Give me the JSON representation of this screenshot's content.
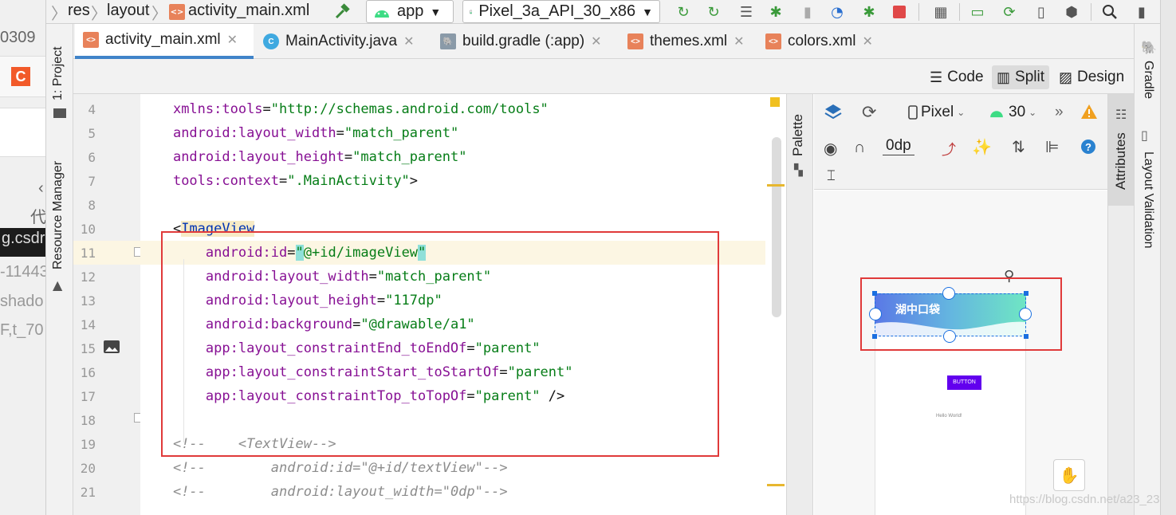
{
  "browser_strip": {
    "text1": "0309",
    "c_label": "C",
    "text2": "代",
    "dark_text": "g.csdr",
    "text3": "-11443",
    "text4": "shado",
    "text5": "F,t_70"
  },
  "toolbar": {
    "breadcrumbs": [
      "res",
      "layout",
      "activity_main.xml"
    ],
    "run_config": "app",
    "device": "Pixel_3a_API_30_x86"
  },
  "left_tools": {
    "project": "1: Project",
    "resource_manager": "Resource Manager"
  },
  "tabs": [
    {
      "label": "activity_main.xml",
      "active": true,
      "icon": "xml-file-icon"
    },
    {
      "label": "MainActivity.java",
      "active": false,
      "icon": "java-class-icon"
    },
    {
      "label": "build.gradle (:app)",
      "active": false,
      "icon": "gradle-icon"
    },
    {
      "label": "themes.xml",
      "active": false,
      "icon": "xml-file-icon"
    },
    {
      "label": "colors.xml",
      "active": false,
      "icon": "xml-file-icon"
    }
  ],
  "modes": {
    "code": "Code",
    "split": "Split",
    "design": "Design",
    "active": "Split"
  },
  "editor": {
    "lines": [
      {
        "n": "4",
        "parts": [
          {
            "t": "    "
          },
          {
            "c": "attr",
            "t": "xmlns:tools"
          },
          {
            "c": "punct",
            "t": "="
          },
          {
            "c": "val",
            "t": "\"http://schemas.android.com/tools\""
          }
        ]
      },
      {
        "n": "5",
        "parts": [
          {
            "t": "    "
          },
          {
            "c": "attr",
            "t": "android:layout_width"
          },
          {
            "c": "punct",
            "t": "="
          },
          {
            "c": "val",
            "t": "\"match_parent\""
          }
        ]
      },
      {
        "n": "6",
        "parts": [
          {
            "t": "    "
          },
          {
            "c": "attr",
            "t": "android:layout_height"
          },
          {
            "c": "punct",
            "t": "="
          },
          {
            "c": "val",
            "t": "\"match_parent\""
          }
        ]
      },
      {
        "n": "7",
        "parts": [
          {
            "t": "    "
          },
          {
            "c": "attr",
            "t": "tools:context"
          },
          {
            "c": "punct",
            "t": "="
          },
          {
            "c": "val",
            "t": "\".MainActivity\""
          },
          {
            "c": "punct",
            "t": ">"
          }
        ]
      },
      {
        "n": "8",
        "parts": []
      },
      {
        "n": "10",
        "parts": [
          {
            "t": "    "
          },
          {
            "c": "punct",
            "t": "<"
          },
          {
            "c": "tag tagbg",
            "t": "ImageView"
          }
        ]
      },
      {
        "n": "11",
        "current": true,
        "parts": [
          {
            "t": "        "
          },
          {
            "c": "attr",
            "t": "android:id"
          },
          {
            "c": "punct",
            "t": "="
          },
          {
            "c": "val hl",
            "t": "\""
          },
          {
            "c": "val",
            "t": "@+id/imageView"
          },
          {
            "c": "val hl",
            "t": "\""
          }
        ]
      },
      {
        "n": "12",
        "parts": [
          {
            "t": "        "
          },
          {
            "c": "attr",
            "t": "android:layout_width"
          },
          {
            "c": "punct",
            "t": "="
          },
          {
            "c": "val",
            "t": "\"match_parent\""
          }
        ]
      },
      {
        "n": "13",
        "parts": [
          {
            "t": "        "
          },
          {
            "c": "attr",
            "t": "android:layout_height"
          },
          {
            "c": "punct",
            "t": "="
          },
          {
            "c": "val",
            "t": "\"117dp\""
          }
        ]
      },
      {
        "n": "14",
        "parts": [
          {
            "t": "        "
          },
          {
            "c": "attr",
            "t": "android:background"
          },
          {
            "c": "punct",
            "t": "="
          },
          {
            "c": "val",
            "t": "\"@drawable/a1\""
          }
        ]
      },
      {
        "n": "15",
        "parts": [
          {
            "t": "        "
          },
          {
            "c": "attr",
            "t": "app:layout_constraintEnd_toEndOf"
          },
          {
            "c": "punct",
            "t": "="
          },
          {
            "c": "val",
            "t": "\"parent\""
          }
        ]
      },
      {
        "n": "16",
        "parts": [
          {
            "t": "        "
          },
          {
            "c": "attr",
            "t": "app:layout_constraintStart_toStartOf"
          },
          {
            "c": "punct",
            "t": "="
          },
          {
            "c": "val",
            "t": "\"parent\""
          }
        ]
      },
      {
        "n": "17",
        "parts": [
          {
            "t": "        "
          },
          {
            "c": "attr",
            "t": "app:layout_constraintTop_toTopOf"
          },
          {
            "c": "punct",
            "t": "="
          },
          {
            "c": "val",
            "t": "\"parent\""
          },
          {
            "c": "punct",
            "t": " />"
          }
        ]
      },
      {
        "n": "18",
        "parts": []
      },
      {
        "n": "19",
        "parts": [
          {
            "t": "    "
          },
          {
            "c": "comment",
            "t": "<!--    <TextView-->"
          }
        ]
      },
      {
        "n": "20",
        "parts": [
          {
            "t": "    "
          },
          {
            "c": "comment",
            "t": "<!--        android:id=\"@+id/textView\"-->"
          }
        ]
      },
      {
        "n": "21",
        "parts": [
          {
            "t": "    "
          },
          {
            "c": "comment",
            "t": "<!--        android:layout_width=\"0dp\"-->"
          }
        ]
      }
    ]
  },
  "palette_label": "Palette",
  "design_toolbar": {
    "device": "Pixel",
    "api": "30",
    "margin": "0dp"
  },
  "preview": {
    "banner_text": "湖中口袋",
    "button_label": "BUTTON",
    "hello_text": "Hello World!"
  },
  "attributes_label": "Attributes",
  "right_tools": {
    "gradle": "Gradle",
    "layout_validation": "Layout Validation"
  },
  "watermark": "https://blog.csdn.net/a23_23",
  "colors": {
    "accent": "#4083c9",
    "selection": "#1a6fe0",
    "annotation_box": "#e03a3a",
    "button": "#6200ee"
  }
}
